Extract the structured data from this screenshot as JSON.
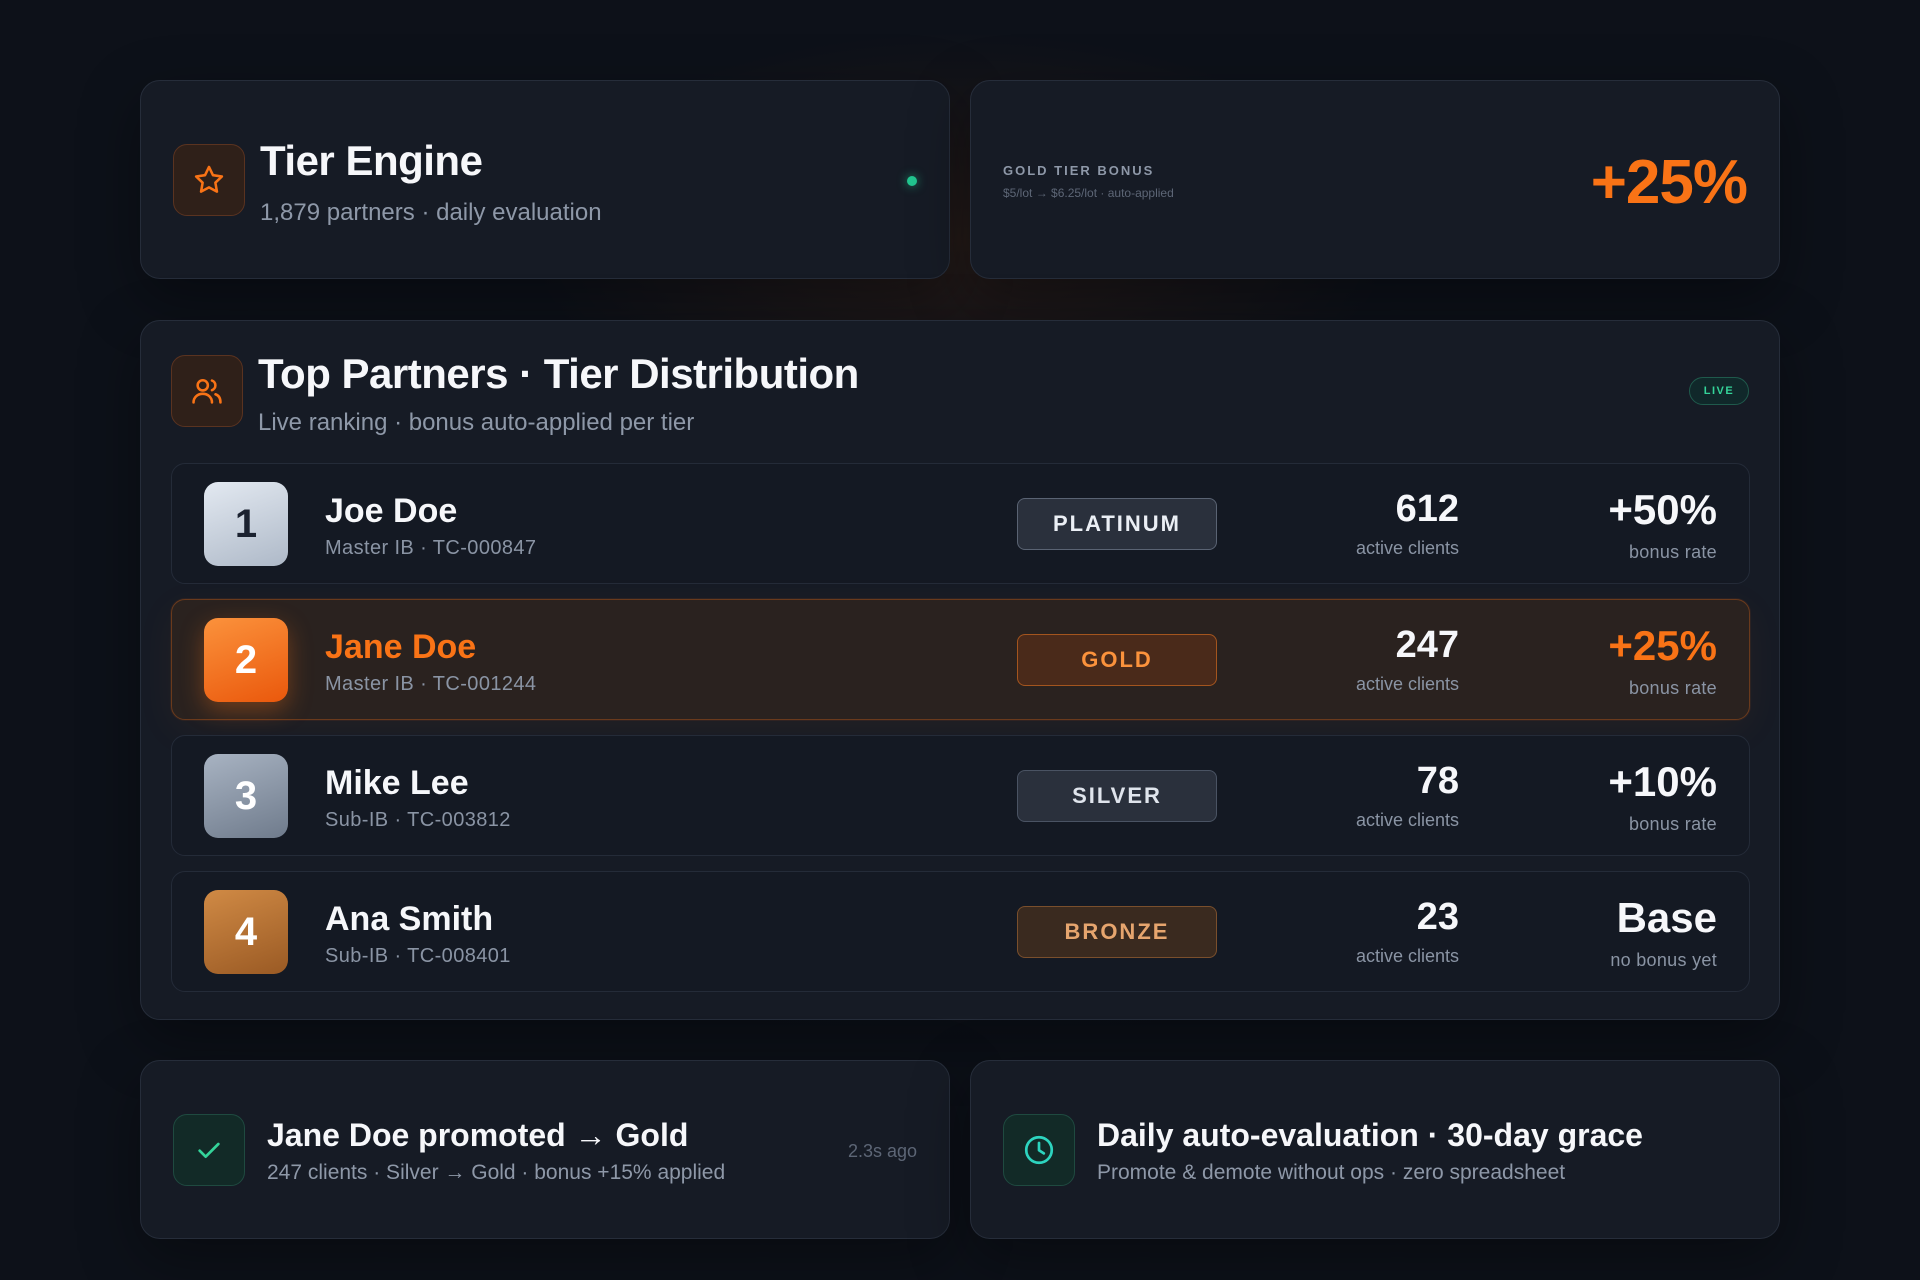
{
  "engine": {
    "title": "Tier Engine",
    "subtitle": "1,879 partners · daily evaluation",
    "icon": "star-icon"
  },
  "bonus": {
    "label": "GOLD TIER BONUS",
    "detail": "$5/lot → $6.25/lot · auto-applied",
    "value": "+25%"
  },
  "partners": {
    "title": "Top Partners · Tier Distribution",
    "subtitle": "Live ranking · bonus auto-applied per tier",
    "live_label": "LIVE",
    "icon": "users-icon",
    "rows": [
      {
        "rank": "1",
        "name": "Joe Doe",
        "meta": "Master IB · TC-000847",
        "tier": "PLATINUM",
        "clients": "612",
        "clients_label": "active clients",
        "rate": "+50%",
        "rate_label": "bonus rate"
      },
      {
        "rank": "2",
        "name": "Jane Doe",
        "meta": "Master IB · TC-001244",
        "tier": "GOLD",
        "clients": "247",
        "clients_label": "active clients",
        "rate": "+25%",
        "rate_label": "bonus rate"
      },
      {
        "rank": "3",
        "name": "Mike Lee",
        "meta": "Sub-IB · TC-003812",
        "tier": "SILVER",
        "clients": "78",
        "clients_label": "active clients",
        "rate": "+10%",
        "rate_label": "bonus rate"
      },
      {
        "rank": "4",
        "name": "Ana Smith",
        "meta": "Sub-IB · TC-008401",
        "tier": "BRONZE",
        "clients": "23",
        "clients_label": "active clients",
        "rate": "Base",
        "rate_label": "no bonus yet"
      }
    ]
  },
  "promotion": {
    "title": "Jane Doe promoted → Gold",
    "subtitle": "247 clients · Silver → Gold · bonus +15% applied",
    "time": "2.3s ago",
    "icon": "check-icon"
  },
  "evaluation": {
    "title": "Daily auto-evaluation · 30-day grace",
    "subtitle": "Promote & demote without ops · zero spreadsheet",
    "icon": "clock-icon"
  },
  "colors": {
    "accent": "#f97316",
    "live_green": "#34d399",
    "background": "#0d1119",
    "card": "#161b25"
  }
}
